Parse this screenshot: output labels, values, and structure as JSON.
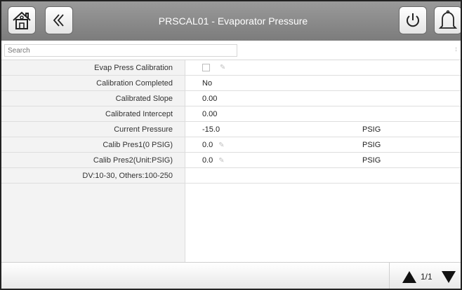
{
  "header": {
    "title": "PRSCAL01 - Evaporator Pressure",
    "buttons": [
      {
        "name": "home-button",
        "icon": "home-icon"
      },
      {
        "name": "back-button",
        "icon": "double-chevron-left-icon"
      },
      {
        "name": "power-button",
        "icon": "power-icon"
      },
      {
        "name": "alarm-button",
        "icon": "bell-icon"
      }
    ]
  },
  "search": {
    "placeholder": "Search",
    "sort_icon": "sort-icon"
  },
  "rows": [
    {
      "label": "Evap Press Calibration",
      "value": "",
      "unit": "",
      "checkbox": true,
      "editable": true
    },
    {
      "label": "Calibration Completed",
      "value": "No",
      "unit": ""
    },
    {
      "label": "Calibrated Slope",
      "value": "0.00",
      "unit": ""
    },
    {
      "label": "Calibrated Intercept",
      "value": "0.00",
      "unit": ""
    },
    {
      "label": "Current Pressure",
      "value": "-15.0",
      "unit": "PSIG"
    },
    {
      "label": "Calib Pres1(0 PSIG)",
      "value": "0.0",
      "unit": "PSIG",
      "editable": true
    },
    {
      "label": "Calib Pres2(Unit:PSIG)",
      "value": "0.0",
      "unit": "PSIG",
      "editable": true
    },
    {
      "label": "DV:10-30, Others:100-250",
      "value": "",
      "unit": ""
    }
  ],
  "pager": {
    "text": "1/1"
  },
  "colors": {
    "header": "#8a8a8a",
    "label_bg": "#f3f3f3",
    "title_text": "#ffffff"
  }
}
